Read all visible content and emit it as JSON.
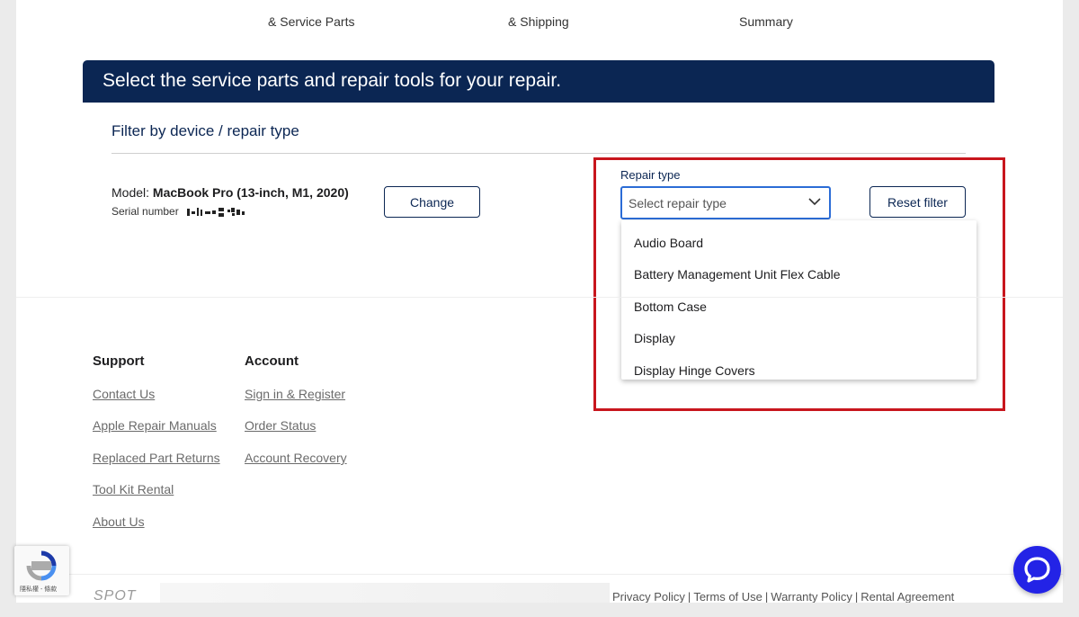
{
  "steps": [
    "& Service Parts",
    "& Shipping",
    "Summary"
  ],
  "banner": {
    "title": "Select the service parts and repair tools for your repair."
  },
  "filter": {
    "title": "Filter by device / repair type",
    "model_label": "Model:",
    "model_value": "MacBook Pro (13-inch, M1, 2020)",
    "serial_label": "Serial number",
    "change_button": "Change",
    "repair_type_label": "Repair type",
    "select_placeholder": "Select repair type",
    "reset_button": "Reset filter",
    "options": [
      "Audio Board",
      "Battery Management Unit Flex Cable",
      "Bottom Case",
      "Display",
      "Display Hinge Covers"
    ]
  },
  "footer": {
    "support": {
      "heading": "Support",
      "links": [
        "Contact Us",
        "Apple Repair Manuals",
        "Replaced Part Returns",
        "Tool Kit Rental",
        "About Us"
      ]
    },
    "account": {
      "heading": "Account",
      "links": [
        "Sign in & Register",
        "Order Status",
        "Account Recovery"
      ]
    },
    "logo": "SPOT",
    "legal": [
      "Privacy Policy",
      "Terms of Use",
      "Warranty Policy",
      "Rental Agreement"
    ]
  },
  "recaptcha": {
    "text": "隱私權 - 條款"
  },
  "colors": {
    "navy": "#0b2653",
    "highlight": "#c8161d",
    "focus": "#2b6cd6",
    "chat": "#2323e6"
  },
  "icons": {
    "chevron": "chevron-down-icon",
    "chat": "chat-bubble-icon",
    "recaptcha": "recaptcha-icon"
  }
}
